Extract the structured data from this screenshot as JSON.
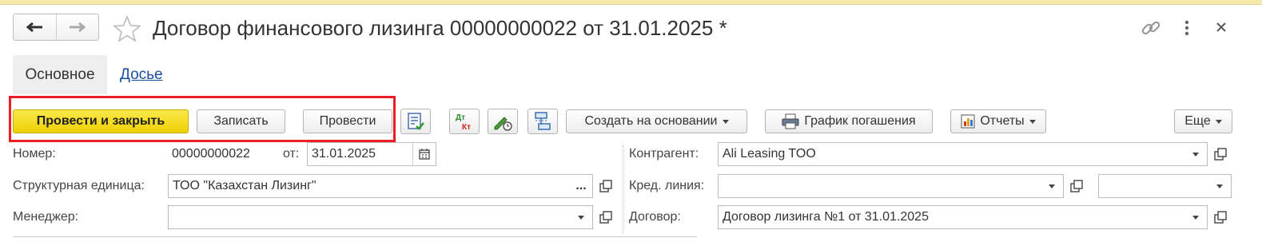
{
  "window": {
    "title": "Договор финансового лизинга 00000000022 от 31.01.2025 *",
    "back_icon": "arrow-left-icon",
    "forward_icon": "arrow-right-icon",
    "favorite_icon": "star-icon",
    "link_icon": "link-icon",
    "more_icon": "vertical-dots-icon",
    "close_icon": "close-icon"
  },
  "tabs": [
    {
      "label": "Основное",
      "active": true
    },
    {
      "label": "Досье",
      "active": false
    }
  ],
  "toolbar": {
    "post_close_label": "Провести и закрыть",
    "save_label": "Записать",
    "post_label": "Провести",
    "create_based_label": "Создать на основании",
    "schedule_label": "График погашения",
    "reports_label": "Отчеты",
    "more_label": "Еще",
    "dt_kt_top": "Дт",
    "dt_kt_bottom": "Кт"
  },
  "form": {
    "number_label": "Номер:",
    "number_value": "00000000022",
    "date_label": "от:",
    "date_value": "31.01.2025",
    "unit_label": "Структурная единица:",
    "unit_value": "ТОО \"Казахстан Лизинг\"",
    "unit_ellipsis": "...",
    "manager_label": "Менеджер:",
    "manager_value": "",
    "counterparty_label": "Контрагент:",
    "counterparty_value": "Ali Leasing TOO",
    "credit_line_label": "Кред. линия:",
    "credit_line_value": "",
    "credit_line_extra_value": "",
    "contract_label": "Договор:",
    "contract_value": "Договор лизинга №1 от 31.01.2025"
  },
  "colors": {
    "primary_button": "#f2d60c",
    "highlight_frame": "#ee1c24",
    "link": "#1a4fa3"
  }
}
